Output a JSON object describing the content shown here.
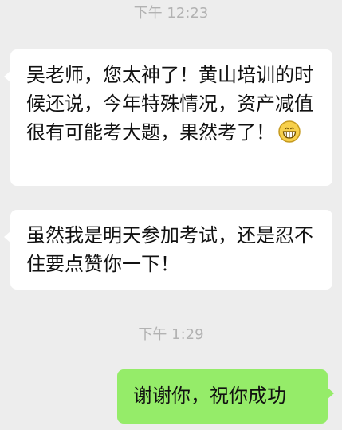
{
  "chat": {
    "timestamps": {
      "first": "下午 12:23",
      "second": "下午 1:29"
    },
    "messages": [
      {
        "text": "吴老师，您太神了！黄山培训的时候还说，今年特殊情况，资产减值很有可能考大题，果然考了！",
        "emoji": "grinning-face-icon"
      },
      {
        "text": "虽然我是明天参加考试，还是忍不住要点赞你一下！"
      },
      {
        "text": "谢谢你，祝你成功"
      }
    ]
  },
  "colors": {
    "background": "#ededed",
    "incoming_bubble": "#ffffff",
    "outgoing_bubble": "#95ec69",
    "timestamp": "#b2b2b2",
    "text": "#111111"
  }
}
